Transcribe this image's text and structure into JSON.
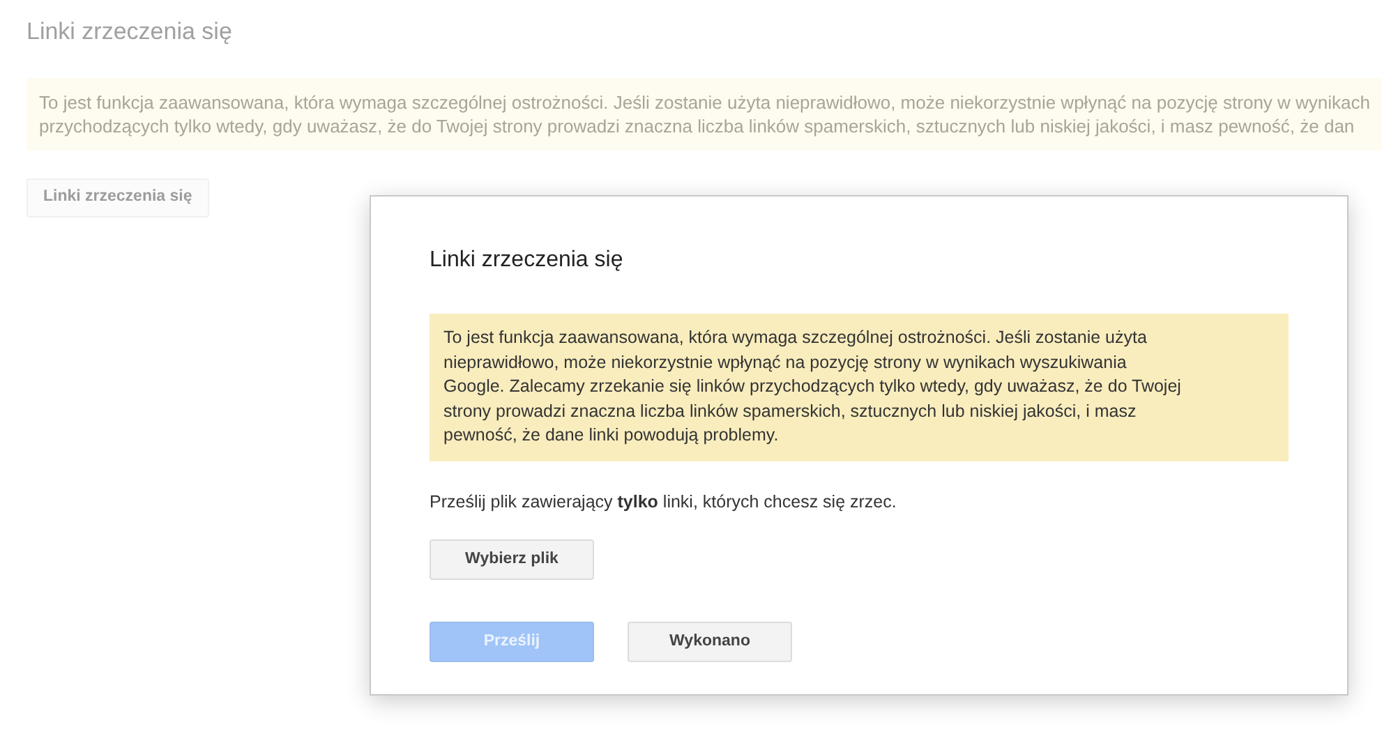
{
  "page": {
    "title": "Linki zrzeczenia się",
    "warning_lines": [
      "To jest funkcja zaawansowana, która wymaga szczególnej ostrożności. Jeśli zostanie użyta nieprawidłowo, może niekorzystnie wpłynąć na pozycję strony w wynikach",
      "przychodzących tylko wtedy, gdy uważasz, że do Twojej strony prowadzi znaczna liczba linków spamerskich, sztucznych lub niskiej jakości, i masz pewność, że dan"
    ],
    "button": "Linki zrzeczenia się"
  },
  "dialog": {
    "title": "Linki zrzeczenia się",
    "warning": "To jest funkcja zaawansowana, która wymaga szczególnej ostrożności. Jeśli zostanie użyta nieprawidłowo, może niekorzystnie wpłynąć na pozycję strony w wynikach wyszukiwania Google. Zalecamy zrzekanie się linków przychodzących tylko wtedy, gdy uważasz, że do Twojej strony prowadzi znaczna liczba linków spamerskich, sztucznych lub niskiej jakości, i masz pewność, że dane linki powodują problemy.",
    "instruction": "Prześlij plik zawierający **tylko** linki, których chcesz się zrzec.",
    "choose_file_button": "Wybierz plik",
    "actions": [
      {
        "label": "Prześlij",
        "kind": "primary",
        "disabled": true
      },
      {
        "label": "Wykonano",
        "kind": "secondary",
        "disabled": false
      }
    ]
  }
}
